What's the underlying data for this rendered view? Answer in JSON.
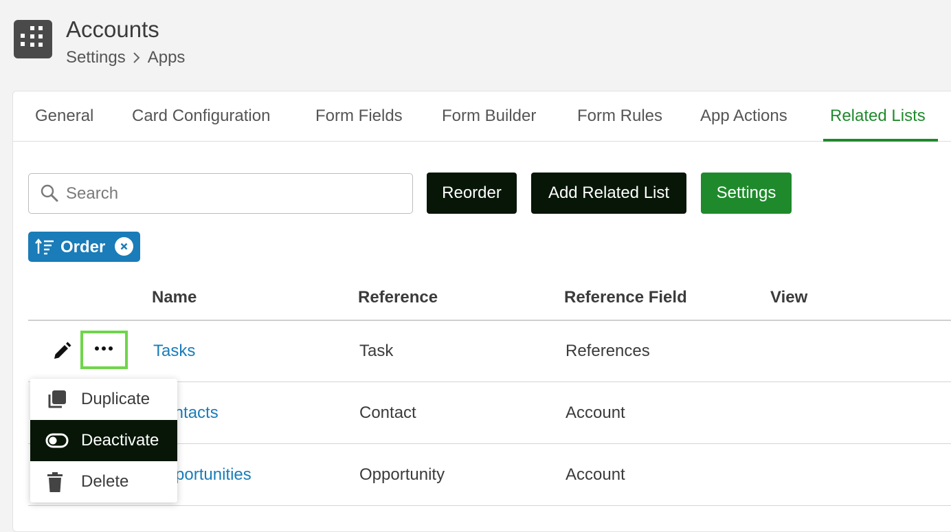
{
  "header": {
    "title": "Accounts",
    "breadcrumb": [
      "Settings",
      "Apps"
    ]
  },
  "tabs": [
    {
      "label": "General",
      "active": false
    },
    {
      "label": "Card Configuration",
      "active": false
    },
    {
      "label": "Form Fields",
      "active": false
    },
    {
      "label": "Form Builder",
      "active": false
    },
    {
      "label": "Form Rules",
      "active": false
    },
    {
      "label": "App Actions",
      "active": false
    },
    {
      "label": "Related Lists",
      "active": true
    }
  ],
  "toolbar": {
    "search_placeholder": "Search",
    "reorder_label": "Reorder",
    "add_related_list_label": "Add Related List",
    "settings_label": "Settings"
  },
  "filter_chip": {
    "label": "Order",
    "icon": "sort-ascending-icon"
  },
  "table": {
    "columns": [
      "Name",
      "Reference",
      "Reference Field",
      "View"
    ],
    "rows": [
      {
        "name": "Tasks",
        "reference": "Task",
        "reference_field": "References",
        "view": ""
      },
      {
        "name": "Contacts",
        "reference": "Contact",
        "reference_field": "Account",
        "view": ""
      },
      {
        "name": "Opportunities",
        "reference": "Opportunity",
        "reference_field": "Account",
        "view": ""
      }
    ]
  },
  "context_menu": {
    "items": [
      {
        "label": "Duplicate",
        "icon": "duplicate-icon"
      },
      {
        "label": "Deactivate",
        "icon": "toggle-icon",
        "highlighted": true
      },
      {
        "label": "Delete",
        "icon": "trash-icon"
      }
    ]
  },
  "colors": {
    "accent_green": "#1f8a2c",
    "link_blue": "#1a7cb8",
    "dark_button": "#071607",
    "highlight_border": "#6fd54b"
  }
}
